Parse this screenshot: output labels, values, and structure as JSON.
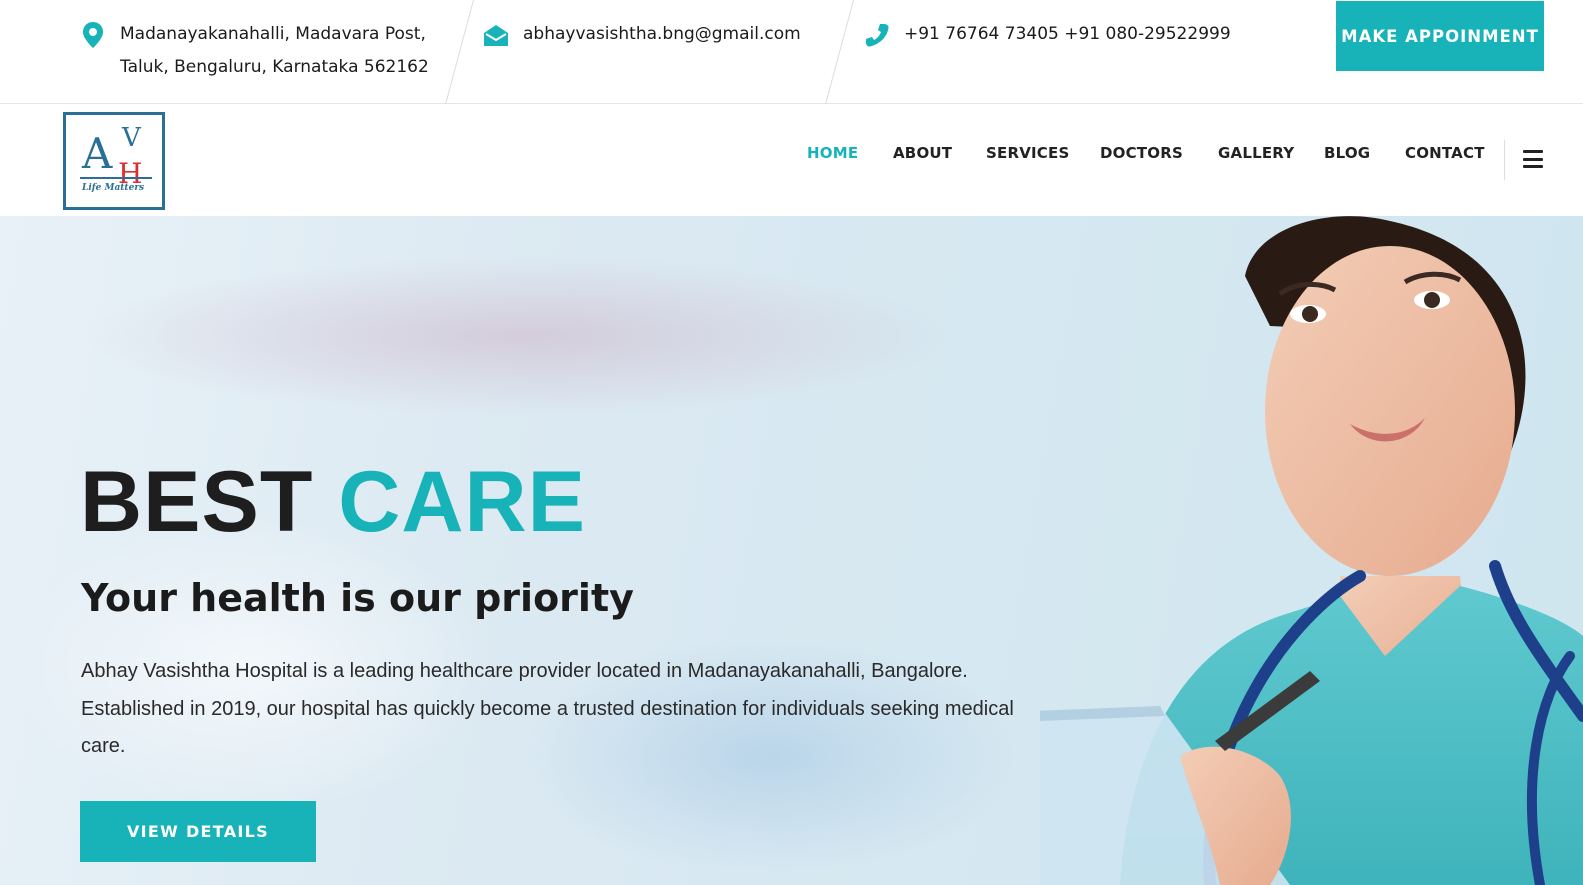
{
  "topbar": {
    "address_line1": "Madanayakanahalli, Madavara Post,",
    "address_line2": "Taluk, Bengaluru, Karnataka 562162",
    "email": "abhayvasishtha.bng@gmail.com",
    "phone": "+91 76764 73405 +91 080-29522999",
    "appointment_label": "MAKE APPOINMENT",
    "icons": [
      "map-pin-icon",
      "envelope-icon",
      "phone-icon"
    ]
  },
  "logo": {
    "letter_a": "A",
    "letter_v": "V",
    "letter_h": "H",
    "tagline": "Life Matters"
  },
  "nav": {
    "items": [
      {
        "label": "HOME",
        "active": true
      },
      {
        "label": "ABOUT",
        "active": false
      },
      {
        "label": "SERVICES",
        "active": false
      },
      {
        "label": "DOCTORS",
        "active": false
      },
      {
        "label": "GALLERY",
        "active": false
      },
      {
        "label": "BLOG",
        "active": false
      },
      {
        "label": "CONTACT",
        "active": false
      }
    ],
    "menu_icon": "hamburger-menu-icon"
  },
  "hero": {
    "title_word1": "BEST",
    "title_word2": "CARE",
    "subtitle": "Your health is our priority",
    "description": "Abhay Vasishtha Hospital is a leading healthcare provider located in Madanayakanahalli, Bangalore. Established in 2019, our hospital has quickly become a trusted destination for individuals seeking medical care.",
    "button_label": "VIEW DETAILS"
  },
  "colors": {
    "accent": "#17b3b8",
    "dark_text": "#1e1e1e",
    "logo_blue": "#2a6f96",
    "logo_red": "#d8302f"
  }
}
